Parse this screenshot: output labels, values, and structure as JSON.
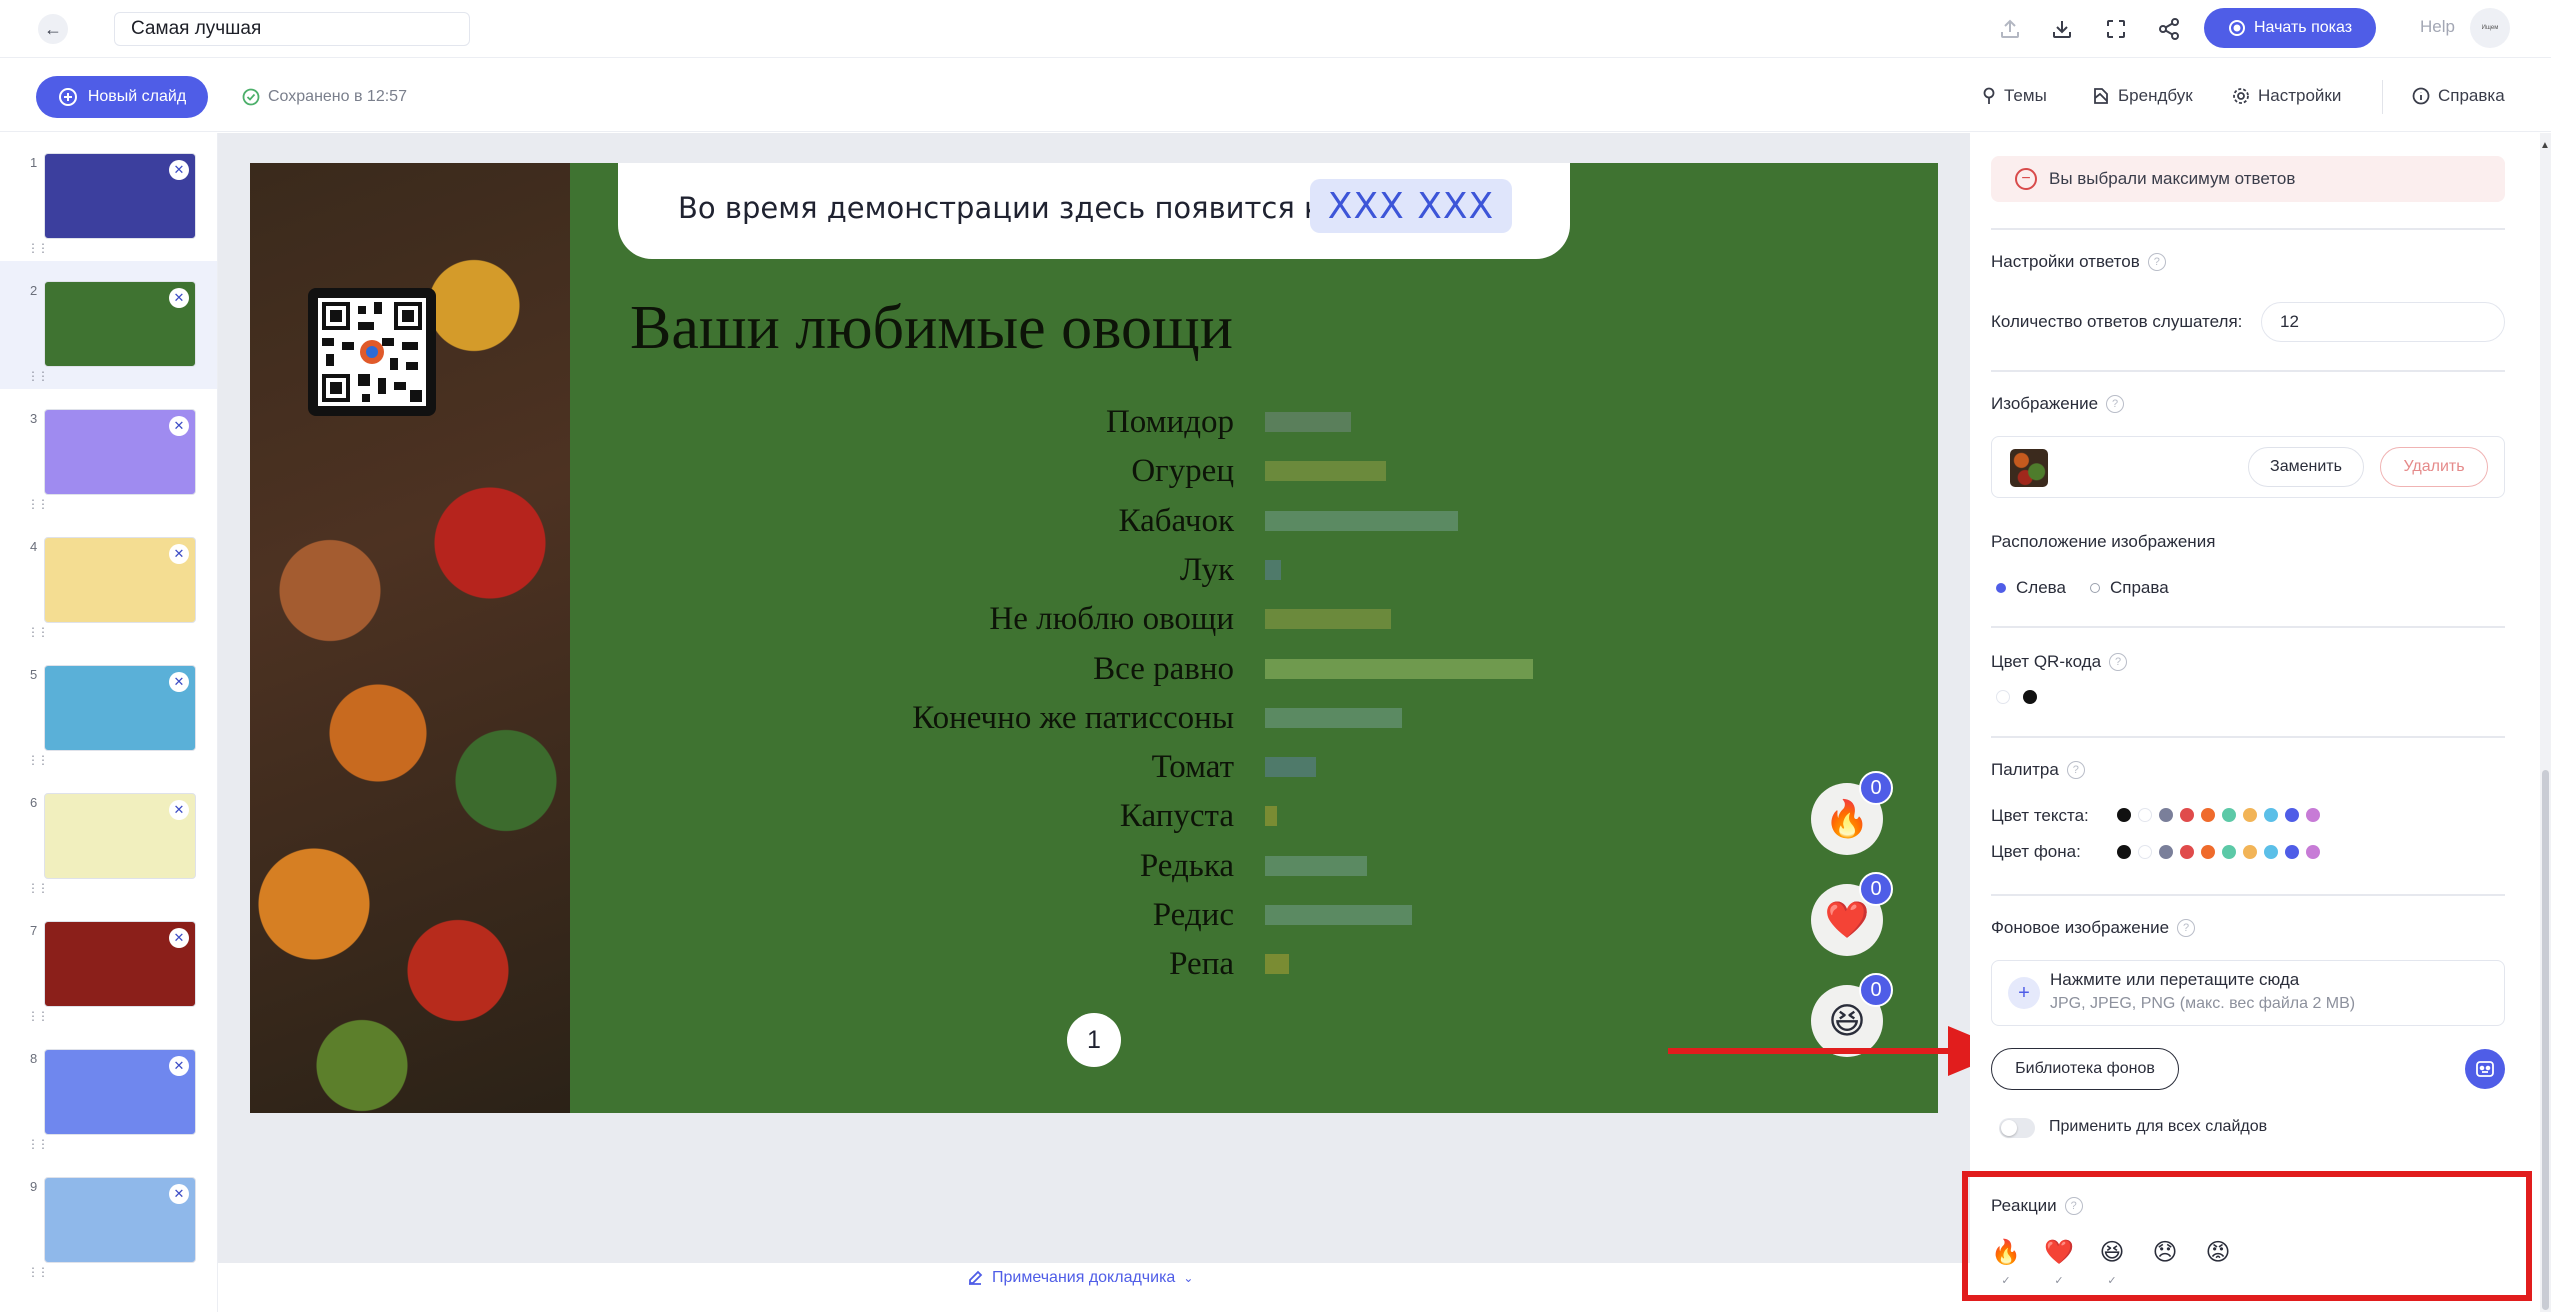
{
  "header": {
    "presentation_title": "Самая лучшая",
    "start_label": "Начать показ",
    "help_label": "Help",
    "avatar_text": "Ищем"
  },
  "toolbar": {
    "new_slide_label": "Новый слайд",
    "saved_label": "Сохранено в 12:57",
    "tabs": [
      {
        "label": "Темы",
        "icon": "pin-icon"
      },
      {
        "label": "Брендбук",
        "icon": "brandbook-icon"
      },
      {
        "label": "Настройки",
        "icon": "gear-icon"
      },
      {
        "label": "Справка",
        "icon": "info-icon"
      }
    ]
  },
  "sidebar": {
    "slides": [
      {
        "number": "1",
        "bg": "#3c3f9e"
      },
      {
        "number": "2",
        "bg": "#3f7331",
        "selected": true
      },
      {
        "number": "3",
        "bg": "#9f8bf0"
      },
      {
        "number": "4",
        "bg": "#f4dd92"
      },
      {
        "number": "5",
        "bg": "#5ab0d8"
      },
      {
        "number": "6",
        "bg": "#f1efbe"
      },
      {
        "number": "7",
        "bg": "#8b1f1a"
      },
      {
        "number": "8",
        "bg": "#6f87ee"
      },
      {
        "number": "9",
        "bg": "#8fb8ea"
      }
    ]
  },
  "slide": {
    "code_prompt": "Во время демонстрации здесь появится код:",
    "code_value": "XXX XXX",
    "title": "Ваши любимые овощи",
    "page_number": "1",
    "answers": [
      {
        "label": "Помидор",
        "value": 0.32,
        "color": "#5a7f5b"
      },
      {
        "label": "Огурец",
        "value": 0.45,
        "color": "#6b8a3c"
      },
      {
        "label": "Кабачок",
        "value": 0.72,
        "color": "#5b8a62"
      },
      {
        "label": "Лук",
        "value": 0.06,
        "color": "#4f7a6a"
      },
      {
        "label": "Не люблю овощи",
        "value": 0.47,
        "color": "#6b8a3c"
      },
      {
        "label": "Все равно",
        "value": 1.0,
        "color": "#6f9a4e"
      },
      {
        "label": "Конечно же патиссоны",
        "value": 0.51,
        "color": "#5b8a62"
      },
      {
        "label": "Томат",
        "value": 0.19,
        "color": "#4f7a6a"
      },
      {
        "label": "Капуста",
        "value": 0.04,
        "color": "#7a8c33"
      },
      {
        "label": "Редька",
        "value": 0.38,
        "color": "#5b8a62"
      },
      {
        "label": "Редис",
        "value": 0.55,
        "color": "#5b8a62"
      },
      {
        "label": "Репа",
        "value": 0.09,
        "color": "#7a8c33"
      }
    ],
    "reactions": [
      {
        "emoji": "🔥",
        "count": "0"
      },
      {
        "emoji": "❤️",
        "count": "0"
      },
      {
        "emoji": "😆",
        "count": "0"
      }
    ]
  },
  "notes_label": "Примечания докладчика",
  "panel": {
    "alert": "Вы выбрали максимум ответов",
    "answer_settings_label": "Настройки ответов",
    "answers_count_label": "Количество ответов слушателя:",
    "answers_count_value": "12",
    "image_label": "Изображение",
    "replace_label": "Заменить",
    "delete_label": "Удалить",
    "image_position_label": "Расположение изображения",
    "position_left": "Слева",
    "position_right": "Справа",
    "qr_color_label": "Цвет QR-кода",
    "palette_label": "Палитра",
    "text_color_label": "Цвет текста:",
    "bg_color_label": "Цвет фона:",
    "palette_colors": [
      "#111111",
      "#ffffff",
      "#7a7f9a",
      "#e04b4b",
      "#ef6b2c",
      "#5cc9a7",
      "#f2b457",
      "#5bbfe8",
      "#4f5de7",
      "#c77bd6"
    ],
    "bg_image_label": "Фоновое изображение",
    "upload_title": "Нажмите или перетащите сюда",
    "upload_sub": "JPG, JPEG, PNG (макс. вес файла 2 MB)",
    "library_label": "Библиотека фонов",
    "apply_all_label": "Применить для всех слайдов",
    "reactions_label": "Реакции",
    "reaction_options": [
      {
        "emoji": "🔥",
        "checked": "✓"
      },
      {
        "emoji": "❤️",
        "checked": "✓"
      },
      {
        "emoji": "😆",
        "checked": "✓"
      },
      {
        "emoji": "😞",
        "checked": ""
      },
      {
        "emoji": "😡",
        "checked": ""
      }
    ]
  }
}
